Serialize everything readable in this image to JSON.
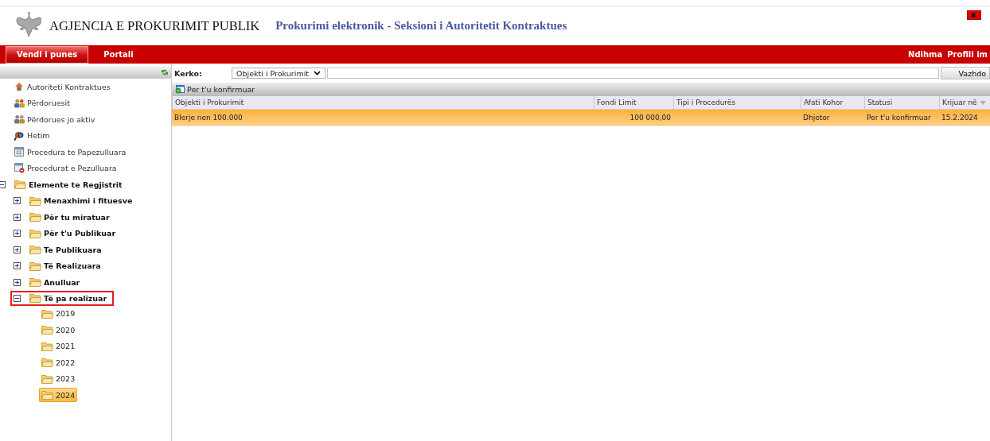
{
  "header": {
    "agency": "AGJENCIA E PROKURIMIT PUBLIK",
    "subtitle": "Prokurimi elektronik - Seksioni i Autoritetit Kontraktues"
  },
  "nav": {
    "tabs": [
      {
        "label": "Vendi i punes",
        "selected": true
      },
      {
        "label": "Portali",
        "selected": false
      }
    ],
    "links": [
      "Ndihma",
      "Profili im"
    ]
  },
  "sidebar": {
    "items": [
      {
        "label": "Autoriteti Kontraktues"
      },
      {
        "label": "Përdoruesit"
      },
      {
        "label": "Përdorues jo aktiv"
      },
      {
        "label": "Hetim"
      },
      {
        "label": "Procedura te Papezulluara"
      },
      {
        "label": "Procedurat e Pezulluara"
      }
    ],
    "tree": [
      {
        "label": "Elemente te Regjistrit",
        "expanded": true,
        "selected": false,
        "highlighted": false,
        "children": [
          {
            "label": "Menaxhimi i fituesve",
            "expanded": false,
            "selected": false,
            "highlighted": false
          },
          {
            "label": "Për tu miratuar",
            "expanded": false,
            "selected": false,
            "highlighted": false
          },
          {
            "label": "Për t'u Publikuar",
            "expanded": false,
            "selected": false,
            "highlighted": false
          },
          {
            "label": "Te Publikuara",
            "expanded": false,
            "selected": false,
            "highlighted": false
          },
          {
            "label": "Të Realizuara",
            "expanded": false,
            "selected": false,
            "highlighted": false
          },
          {
            "label": "Anulluar",
            "expanded": false,
            "selected": false,
            "highlighted": false
          },
          {
            "label": "Të pa realizuar",
            "expanded": true,
            "selected": false,
            "highlighted": true,
            "children": [
              {
                "label": "2019",
                "selected": false,
                "highlighted": false
              },
              {
                "label": "2020",
                "selected": false,
                "highlighted": false
              },
              {
                "label": "2021",
                "selected": false,
                "highlighted": false
              },
              {
                "label": "2022",
                "selected": false,
                "highlighted": false
              },
              {
                "label": "2023",
                "selected": false,
                "highlighted": false
              },
              {
                "label": "2024",
                "selected": true,
                "highlighted": false
              }
            ]
          }
        ]
      }
    ]
  },
  "search": {
    "label": "Kerko:",
    "select": "Objekti i Prokurimit",
    "button": "Vazhdo"
  },
  "toolbar": {
    "label": "Per t'u konfirmuar"
  },
  "table": {
    "columns": [
      {
        "label": "Objekti i Prokurimit",
        "sorted": false
      },
      {
        "label": "Fondi Limit",
        "sorted": false
      },
      {
        "label": "Tipi i Procedurës",
        "sorted": false
      },
      {
        "label": "Afati Kohor",
        "sorted": false
      },
      {
        "label": "Statusi",
        "sorted": false
      },
      {
        "label": "Krijuar në",
        "sorted": true
      }
    ],
    "rows": [
      {
        "selected": true,
        "cells": [
          "Blerje nen 100.000",
          "100 000,00",
          "",
          "Dhjetor",
          "Per t'u konfirmuar",
          "15.2.2024"
        ]
      }
    ]
  }
}
